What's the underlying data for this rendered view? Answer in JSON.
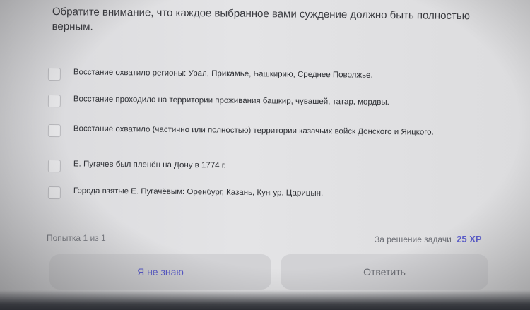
{
  "instruction": "Обратите внимание, что каждое выбранное вами суждение должно быть полностью верным.",
  "options": [
    {
      "label": "Восстание охватило регионы: Урал, Прикамье, Башкирию, Среднее Поволжье."
    },
    {
      "label": "Восстание проходило на территории проживания башкир, чувашей, татар, мордвы."
    },
    {
      "label": "Восстание охватило (частично или полностью) территории казачьих войск Донского и Яицкого."
    },
    {
      "label": "Е. Пугачев был пленён на Дону в 1774 г."
    },
    {
      "label": "Города взятые Е. Пугачёвым: Оренбург, Казань, Кунгур, Царицын."
    }
  ],
  "footer": {
    "attempt": "Попытка 1 из 1",
    "reward_label": "За решение задачи",
    "reward_value": "25 XP"
  },
  "buttons": {
    "dont_know": "Я не знаю",
    "answer": "Ответить"
  },
  "colors": {
    "accent": "#5d5fcf",
    "background": "#e2e2e4",
    "button": "#d2d2d5"
  }
}
